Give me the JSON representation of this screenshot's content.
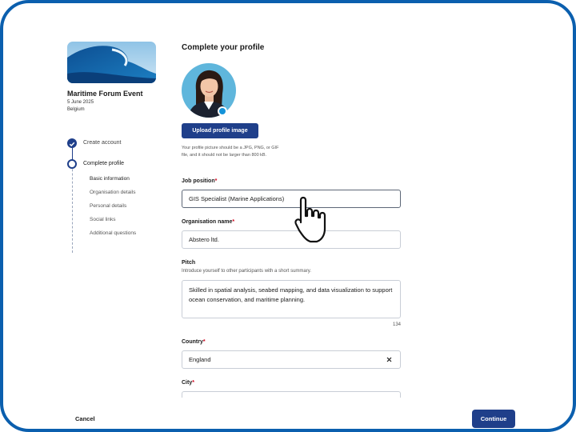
{
  "event": {
    "title": "Maritime Forum Event",
    "date": "5 June 2025",
    "location": "Belgium"
  },
  "steps": [
    {
      "label": "Create account",
      "state": "done"
    },
    {
      "label": "Complete profile",
      "state": "current"
    }
  ],
  "substeps": [
    "Basic information",
    "Organisation details",
    "Personal details",
    "Social links",
    "Additional questions"
  ],
  "main": {
    "title": "Complete your profile",
    "upload_label": "Upload profile image",
    "upload_hint": "Your profile picture should be a JPG, PNG, or GIF file, and it should not be larger than 800 kB."
  },
  "fields": {
    "job": {
      "label": "Job position",
      "value": "GIS Specialist (Marine Applications)"
    },
    "org": {
      "label": "Organisation name",
      "value": "Abstero ltd."
    },
    "pitch": {
      "label": "Pitch",
      "help": "Introduce yourself to other participants with a short summary.",
      "value": "Skilled in spatial analysis, seabed mapping, and data visualization to support ocean conservation, and maritime planning.",
      "count": "134"
    },
    "country": {
      "label": "Country",
      "value": "England"
    },
    "city": {
      "label": "City"
    }
  },
  "footer": {
    "cancel_label": "Cancel",
    "continue_label": "Continue"
  },
  "colors": {
    "frame": "#0b5fae",
    "primary": "#1f3f8a",
    "required": "#d0021b",
    "status": "#1493d9"
  },
  "icons": {
    "check": "check-icon",
    "clear": "clear-icon",
    "cursor": "hand-pointer-icon"
  }
}
